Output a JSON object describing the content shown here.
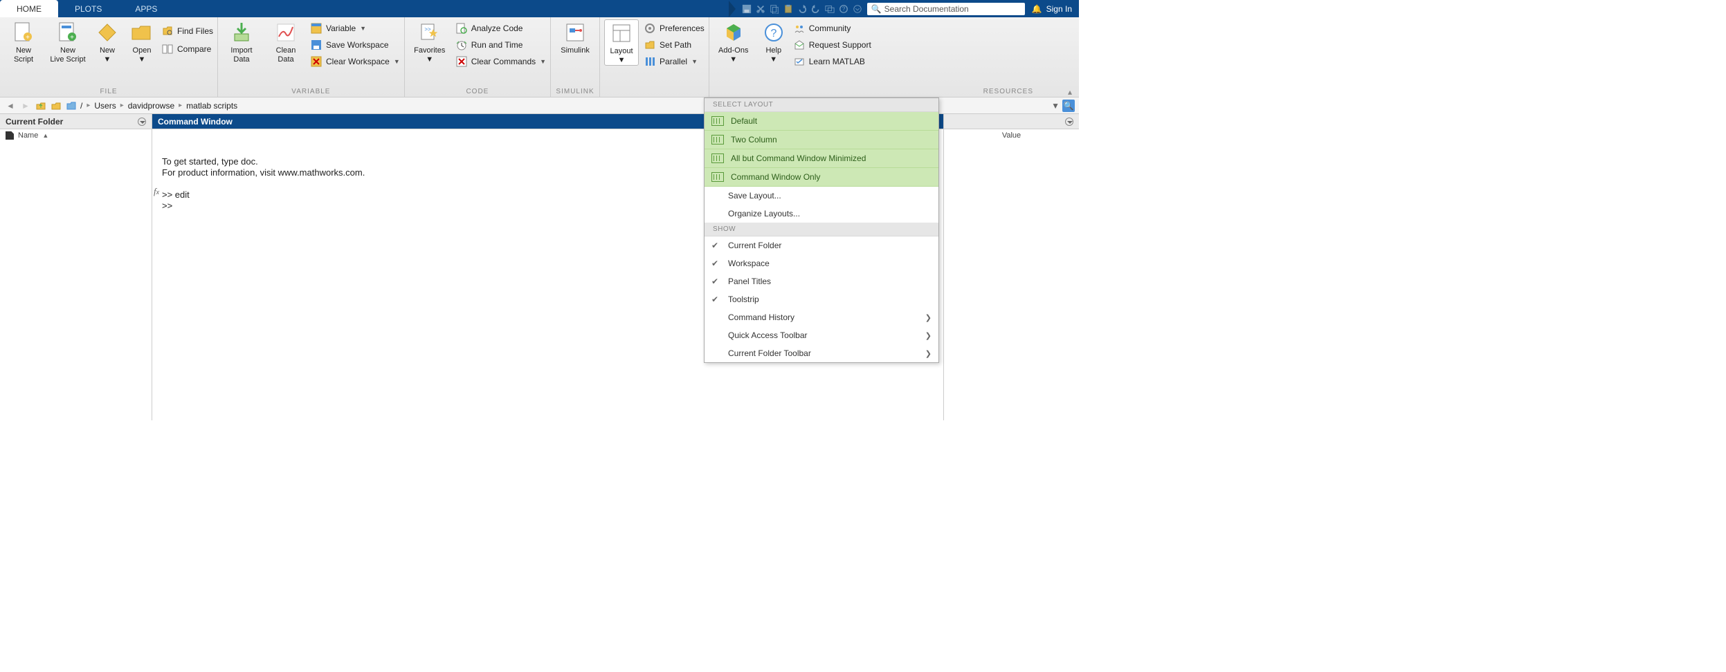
{
  "tabs": {
    "home": "HOME",
    "plots": "PLOTS",
    "apps": "APPS"
  },
  "search": {
    "placeholder": "Search Documentation"
  },
  "signin": "Sign In",
  "ribbon": {
    "file": {
      "label": "FILE",
      "new_script": "New\nScript",
      "new_live_script": "New\nLive Script",
      "new": "New",
      "open": "Open",
      "find_files": "Find Files",
      "compare": "Compare"
    },
    "variable": {
      "label": "VARIABLE",
      "import_data": "Import\nData",
      "clean_data": "Clean\nData",
      "variable": "Variable",
      "save_workspace": "Save Workspace",
      "clear_workspace": "Clear Workspace"
    },
    "code": {
      "label": "CODE",
      "favorites": "Favorites",
      "analyze": "Analyze Code",
      "run_time": "Run and Time",
      "clear_commands": "Clear Commands"
    },
    "simulink": {
      "label": "SIMULINK",
      "btn": "Simulink"
    },
    "environment": {
      "layout": "Layout",
      "preferences": "Preferences",
      "set_path": "Set Path",
      "parallel": "Parallel"
    },
    "resources": {
      "label": "RESOURCES",
      "addons": "Add-Ons",
      "help": "Help",
      "community": "Community",
      "request_support": "Request Support",
      "learn": "Learn MATLAB"
    }
  },
  "path": {
    "root": "/",
    "seg1": "Users",
    "seg2": "davidprowse",
    "seg3": "matlab scripts"
  },
  "panels": {
    "current_folder": "Current Folder",
    "command_window": "Command Window",
    "name": "Name",
    "value": "Value"
  },
  "command_text": "\nTo get started, type doc.\nFor product information, visit www.mathworks.com.\n\n>> edit\n>> ",
  "layout_menu": {
    "select_layout": "SELECT LAYOUT",
    "default": "Default",
    "two_column": "Two Column",
    "all_but": "All but Command Window Minimized",
    "cw_only": "Command Window Only",
    "save_layout": "Save Layout...",
    "organize": "Organize Layouts...",
    "show": "SHOW",
    "current_folder": "Current Folder",
    "workspace": "Workspace",
    "panel_titles": "Panel Titles",
    "toolstrip": "Toolstrip",
    "command_history": "Command History",
    "qat": "Quick Access Toolbar",
    "cft": "Current Folder Toolbar"
  }
}
